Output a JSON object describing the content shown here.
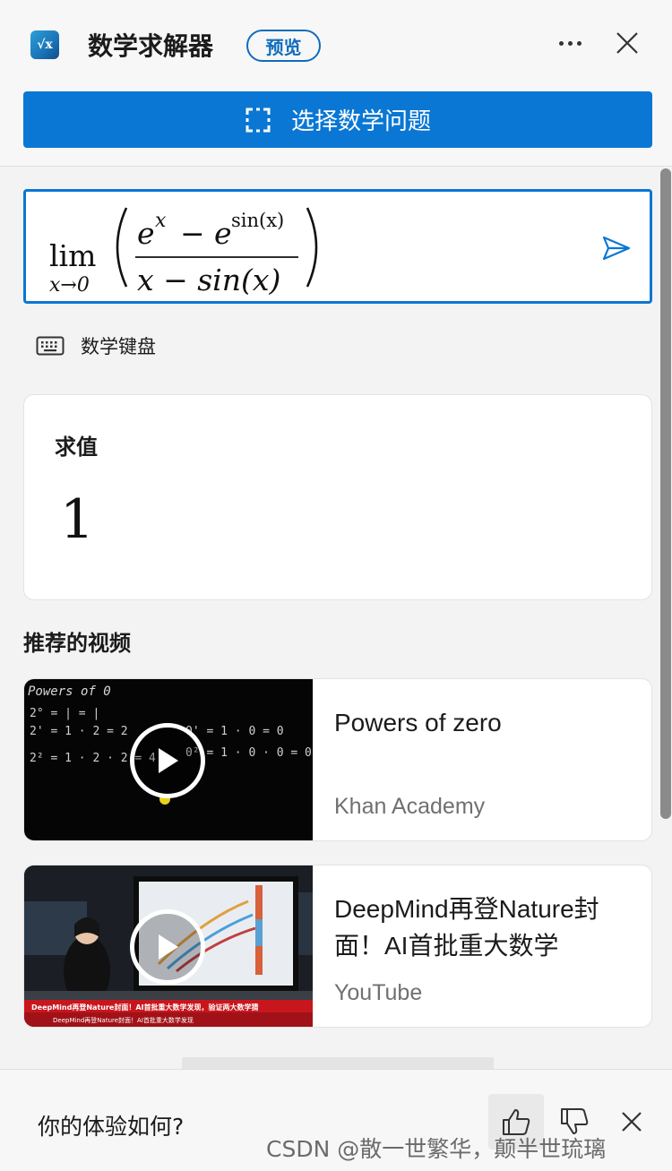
{
  "header": {
    "app_icon_text": "√x",
    "title": "数学求解器",
    "badge": "预览",
    "more_icon": "more-horizontal-icon",
    "close_icon": "close-icon"
  },
  "select_button": {
    "icon": "selection-frame-icon",
    "label": "选择数学问题"
  },
  "math_input": {
    "expression": "\\lim_{x\\to 0}\\left(\\frac{e^x - e^{\\sin(x)}}{x-\\sin(x)}\\right)",
    "lim": "lim",
    "subscript": "x→0",
    "numerator_base1": "e",
    "numerator_exp1": "x",
    "minus": "−",
    "numerator_base2": "e",
    "numerator_exp2": "sin(x)",
    "denominator": "x − sin(x)",
    "send_icon": "send-icon"
  },
  "keyboard": {
    "icon": "keyboard-icon",
    "label": "数学键盘"
  },
  "result": {
    "label": "求值",
    "value": "1"
  },
  "videos_section": {
    "title": "推荐的视频",
    "items": [
      {
        "title": "Powers of zero",
        "source": "Khan Academy",
        "thumb_text": "Powers of 0"
      },
      {
        "title": "DeepMind再登Nature封面！AI首批重大数学",
        "source": "YouTube",
        "thumb_caption": "DeepMind再登Nature封面！AI首批重大数学发现，验证两大数学猜",
        "thumb_subcaption": "DeepMind再登Nature封面！AI首批重大数学发现"
      }
    ]
  },
  "footer": {
    "question": "你的体验如何?",
    "like_icon": "thumbs-up-icon",
    "dislike_icon": "thumbs-down-icon",
    "close_icon": "close-icon"
  },
  "watermark": "CSDN @散一世繁华，颠半世琉璃",
  "colors": {
    "accent": "#0a77d4",
    "badge": "#0f6cbd"
  }
}
